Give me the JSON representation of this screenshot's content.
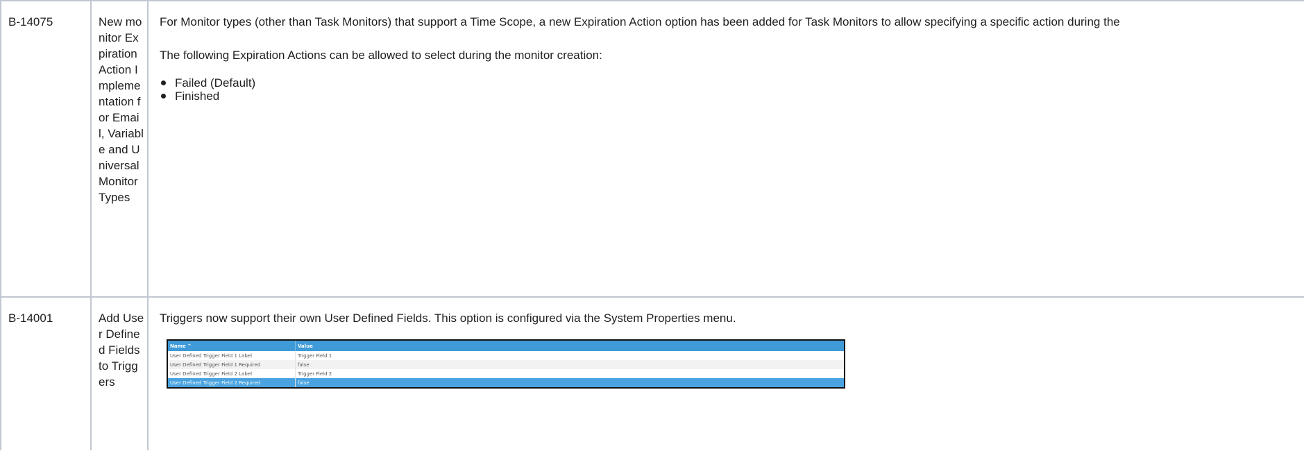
{
  "rows": [
    {
      "key": "B-14075",
      "summary": "New monitor Expiration Action Implementation for Email, Variable and Universal Monitor Types",
      "paragraph1": "For Monitor types (other than Task Monitors) that support a Time Scope, a new Expiration Action option has been added for Task Monitors to allow specifying a specific action during the",
      "paragraph2": "The following Expiration Actions can be allowed to select during the monitor creation:",
      "bullets": [
        "Failed (Default)",
        "Finished"
      ]
    },
    {
      "key": "B-14001",
      "summary": "Add User Defined Fields to Triggers",
      "paragraph1": "Triggers now support their own User Defined Fields. This option is configured via the System Properties menu.",
      "screenshot": {
        "col_name_header": "Name ^",
        "col_value_header": "Value",
        "rows": [
          {
            "name": "User Defined Trigger Field 1 Label",
            "value": "Trigger Field 1"
          },
          {
            "name": "User Defined Trigger Field 1 Required",
            "value": "false"
          },
          {
            "name": "User Defined Trigger Field 2 Label",
            "value": "Trigger Field 2"
          },
          {
            "name": "User Defined Trigger Field 2 Required",
            "value": "false"
          }
        ]
      }
    }
  ]
}
